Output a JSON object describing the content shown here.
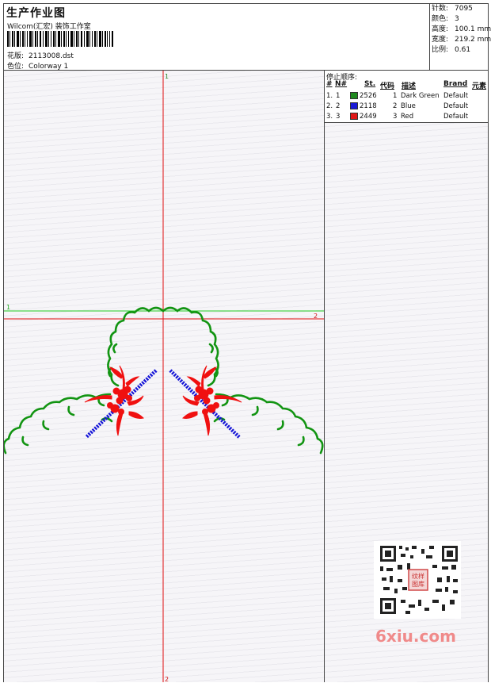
{
  "header": {
    "title": "生产作业图",
    "company": "Wilcom(汇宏) 装饰工作室",
    "design_label": "花版:",
    "design_value": "2113008.dst",
    "colorway_label": "色位:",
    "colorway_value": "Colorway 1"
  },
  "specs": [
    {
      "label": "针数:",
      "value": "7095"
    },
    {
      "label": "颜色:",
      "value": "3"
    },
    {
      "label": "高度:",
      "value": "100.1 mm"
    },
    {
      "label": "宽度:",
      "value": "219.2 mm"
    },
    {
      "label": "比例:",
      "value": "0.61"
    }
  ],
  "axes": {
    "v_top": "1",
    "v_bottom": "2",
    "h_green_left": "1",
    "h_red_right": "2"
  },
  "stop_sequence": {
    "title": "停止顺序:",
    "columns": {
      "num": "#",
      "n": "N#",
      "st": "St.",
      "code": "代码",
      "desc": "描述",
      "brand": "Brand",
      "element": "元素"
    },
    "rows": [
      {
        "num": "1.",
        "n": "1",
        "color": "#1e8a1e",
        "st": "2526",
        "code": "1",
        "desc": "Dark Green",
        "brand": "Default"
      },
      {
        "num": "2.",
        "n": "2",
        "color": "#1a1ad6",
        "st": "2118",
        "code": "2",
        "desc": "Blue",
        "brand": "Default"
      },
      {
        "num": "3.",
        "n": "3",
        "color": "#e01818",
        "st": "2449",
        "code": "3",
        "desc": "Red",
        "brand": "Default"
      }
    ]
  },
  "thread_colors": {
    "green": "#129412",
    "blue": "#1414d8",
    "red": "#f01010"
  },
  "watermark": "6xiu.com",
  "qr_stamp": "纹样图库"
}
